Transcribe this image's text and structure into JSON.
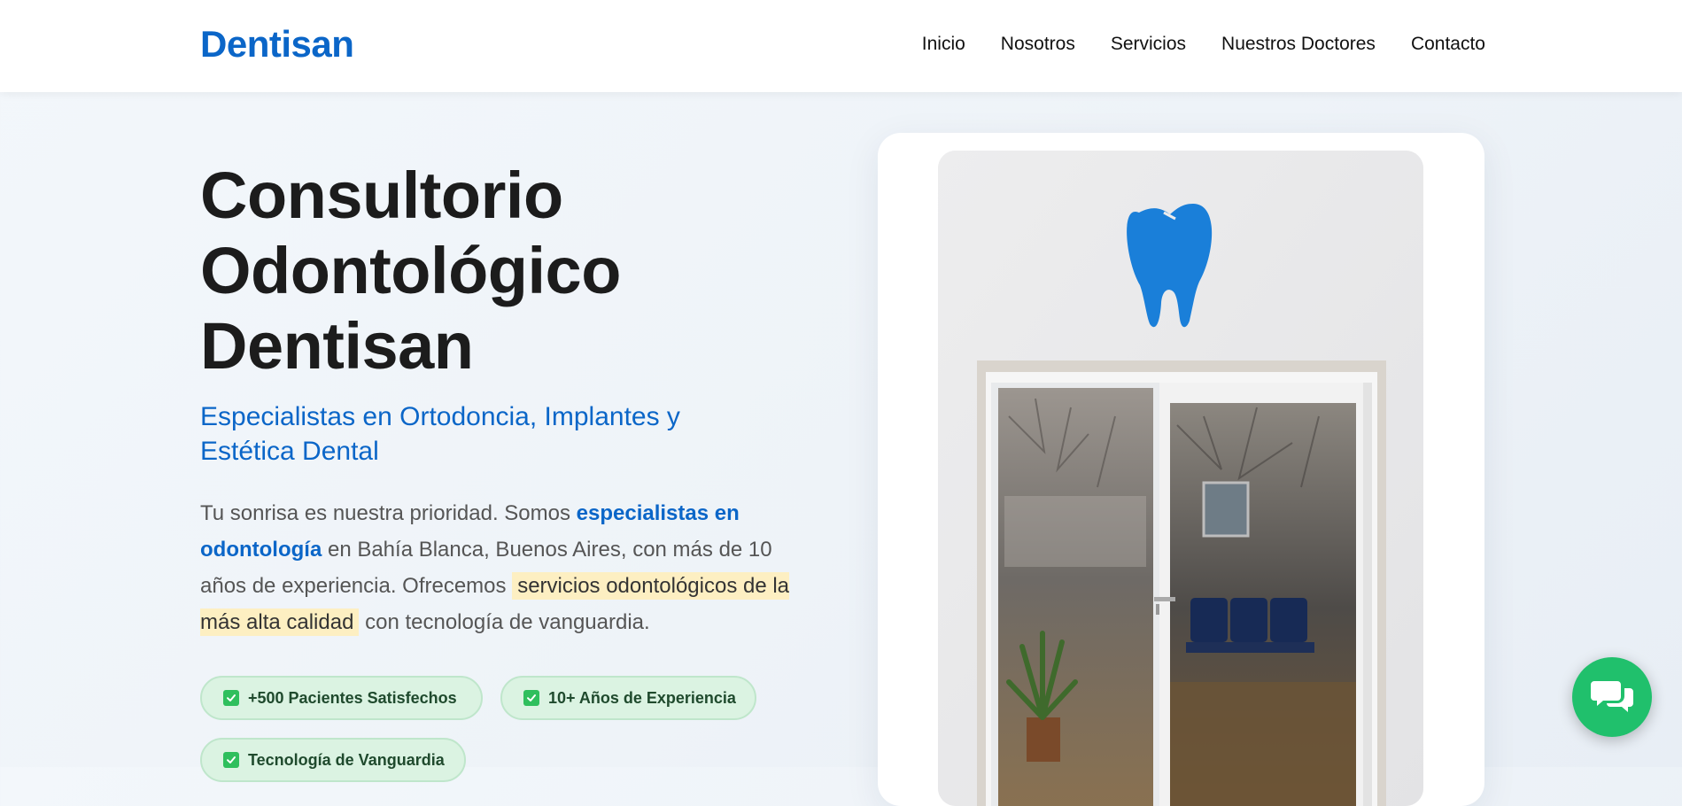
{
  "header": {
    "brand": "Dentisan",
    "nav": [
      "Inicio",
      "Nosotros",
      "Servicios",
      "Nuestros Doctores",
      "Contacto"
    ]
  },
  "hero": {
    "title_lines": [
      "Consultorio",
      "Odontológico",
      "Dentisan"
    ],
    "subtitle": "Especialistas en Ortodoncia, Implantes y Estética Dental",
    "text": {
      "part1": "Tu sonrisa es nuestra prioridad. Somos ",
      "em": "especialistas en odontología",
      "part2": " en Bahía Blanca, Buenos Aires, con más de 10 años de experiencia. Ofrecemos ",
      "highlight": "servicios odontológicos de la más alta calidad",
      "part3": " con tecnología de vanguardia."
    },
    "badges": [
      "+500 Pacientes Satisfechos",
      "10+ Años de Experiencia",
      "Tecnología de Vanguardia"
    ]
  },
  "image": {
    "subject": "clinic-entrance-photo",
    "tooth_color": "#1a7fd9"
  },
  "colors": {
    "brand": "#0b66c8",
    "highlight": "#fdefc2",
    "badge_bg": "#dbf3e2",
    "chat": "#20c06c"
  },
  "icons": {
    "chat": "chat-bubbles-icon",
    "badge": "check-square-icon"
  }
}
